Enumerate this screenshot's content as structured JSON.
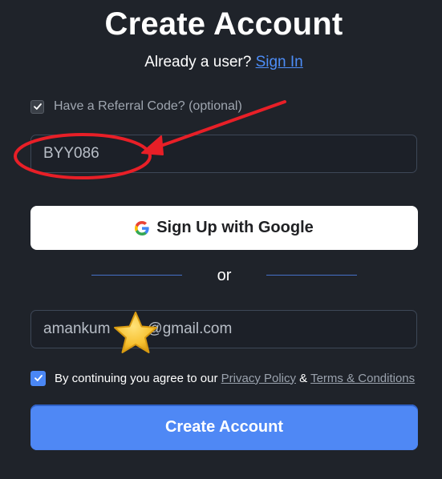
{
  "header": {
    "title": "Create Account",
    "prompt": "Already a user?",
    "signin_label": "Sign In"
  },
  "referral": {
    "checkbox_label": "Have a Referral Code? (optional)",
    "checked": true,
    "code": "BYY086"
  },
  "google": {
    "label": "Sign Up with Google"
  },
  "divider": {
    "label": "or"
  },
  "email": {
    "value_prefix": "amankum",
    "value_suffix": "@gmail.com"
  },
  "terms": {
    "checked": true,
    "text": "By continuing you agree to our",
    "privacy_label": "Privacy Policy",
    "ampersand": "&",
    "conditions_label": "Terms & Conditions"
  },
  "submit": {
    "label": "Create Account"
  },
  "colors": {
    "background": "#1f232a",
    "accent": "#4f88f5",
    "annotation_red": "#e81f27",
    "star": "#f9c436"
  }
}
